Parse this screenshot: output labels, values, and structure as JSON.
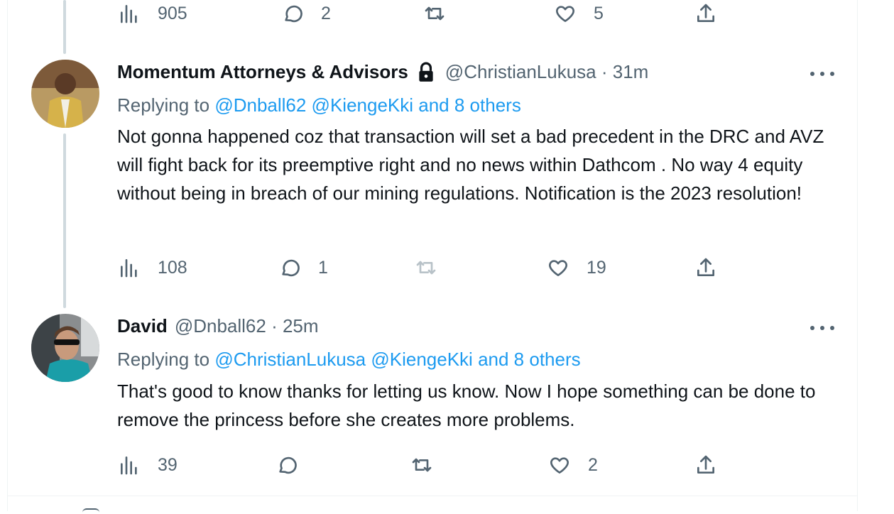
{
  "top_actions": {
    "views": "905",
    "replies": "2",
    "likes": "5"
  },
  "tweets": [
    {
      "name": "Momentum Attorneys & Advisors",
      "handle": "@ChristianLukusa",
      "time": "31m",
      "replying_prefix": "Replying to",
      "replying_mentions": "@Dnball62 @KiengeKki",
      "replying_others": "and 8 others",
      "body": "Not gonna happened coz that transaction will set a bad precedent in the DRC and AVZ will fight back for its preemptive right and no news within Dathcom . No way 4 equity without being in breach of our mining regulations. Notification is the 2023 resolution!",
      "views": "108",
      "replies": "1",
      "likes": "19",
      "avatar_colors": {
        "bg": "#b99a63",
        "suit": "#d6b24a",
        "skin": "#5a3a26"
      }
    },
    {
      "name": "David",
      "handle": "@Dnball62",
      "time": "25m",
      "replying_prefix": "Replying to",
      "replying_mentions": "@ChristianLukusa @KiengeKki",
      "replying_others": "and 8 others",
      "body": "That's good to know thanks for letting us know. Now I hope something can be done to remove the princess before she creates more problems.",
      "views": "39",
      "replies": "",
      "likes": "2",
      "avatar_colors": {
        "bg": "#8a8d8f",
        "shirt": "#1a9ea8",
        "skin": "#c89a7c"
      }
    }
  ],
  "icons": [
    "views-icon",
    "reply-icon",
    "retweet-icon",
    "like-icon",
    "share-icon",
    "lock-icon",
    "more-icon"
  ],
  "colors": {
    "link": "#1d9bf0",
    "muted": "#536471",
    "text": "#0f1419",
    "thread_line": "#cfd9de"
  }
}
